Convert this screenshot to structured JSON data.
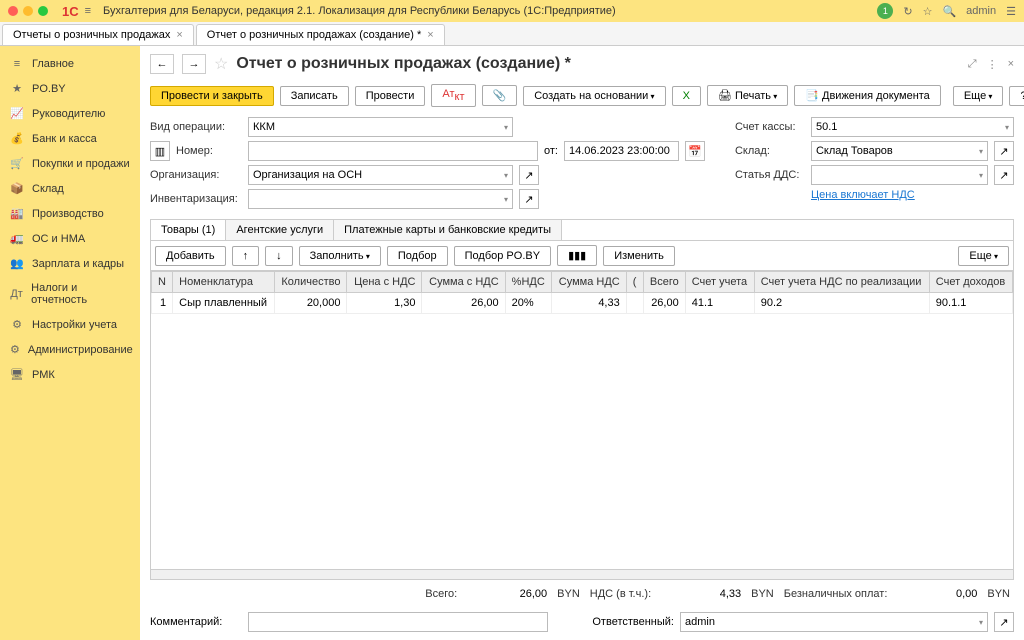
{
  "app_title": "Бухгалтерия для Беларуси, редакция 2.1. Локализация для Республики Беларусь   (1С:Предприятие)",
  "user": "admin",
  "bell_count": "1",
  "doc_tabs": [
    {
      "label": "Отчеты о розничных продажах"
    },
    {
      "label": "Отчет о розничных продажах (создание) *"
    }
  ],
  "sidebar": [
    {
      "icon": "≡",
      "label": "Главное"
    },
    {
      "icon": "★",
      "label": "PO.BY"
    },
    {
      "icon": "📈",
      "label": "Руководителю"
    },
    {
      "icon": "💰",
      "label": "Банк и касса"
    },
    {
      "icon": "🛒",
      "label": "Покупки и продажи"
    },
    {
      "icon": "📦",
      "label": "Склад"
    },
    {
      "icon": "🏭",
      "label": "Производство"
    },
    {
      "icon": "🚛",
      "label": "ОС и НМА"
    },
    {
      "icon": "👥",
      "label": "Зарплата и кадры"
    },
    {
      "icon": "Дт",
      "label": "Налоги и отчетность"
    },
    {
      "icon": "⚙",
      "label": "Настройки учета"
    },
    {
      "icon": "⚙",
      "label": "Администрирование"
    },
    {
      "icon": "🖥",
      "label": "РМК"
    }
  ],
  "page_title": "Отчет о розничных продажах (создание) *",
  "toolbar": {
    "post_close": "Провести и закрыть",
    "save": "Записать",
    "post": "Провести",
    "create_based": "Создать на основании",
    "print": "Печать",
    "movements": "Движения документа",
    "more": "Еще"
  },
  "form": {
    "op_type_label": "Вид операции:",
    "op_type": "ККМ",
    "number_label": "Номер:",
    "number": "",
    "from_label": "от:",
    "date": "14.06.2023 23:00:00",
    "org_label": "Организация:",
    "org": "Организация на ОСН",
    "inv_label": "Инвентаризация:",
    "cash_account_label": "Счет кассы:",
    "cash_account": "50.1",
    "warehouse_label": "Склад:",
    "warehouse": "Склад Товаров",
    "dds_label": "Статья ДДС:",
    "price_link": "Цена включает НДС"
  },
  "subtabs": [
    "Товары (1)",
    "Агентские услуги",
    "Платежные карты и банковские кредиты"
  ],
  "table_toolbar": {
    "add": "Добавить",
    "fill": "Заполнить",
    "pick": "Подбор",
    "pick_poby": "Подбор PO.BY",
    "change": "Изменить",
    "more": "Еще"
  },
  "columns": [
    "N",
    "Номенклатура",
    "Количество",
    "Цена с НДС",
    "Сумма с НДС",
    "%НДС",
    "Сумма НДС",
    "(",
    "Всего",
    "Счет учета",
    "Счет учета НДС по реализации",
    "Счет доходов"
  ],
  "rows": [
    {
      "n": "1",
      "nom": "Сыр плавленный",
      "qty": "20,000",
      "price": "1,30",
      "sum": "26,00",
      "vat_rate": "20%",
      "vat_sum": "4,33",
      "extra": "",
      "total": "26,00",
      "acc": "41.1",
      "acc_vat": "90.2",
      "acc_inc": "90.1.1"
    }
  ],
  "totals": {
    "total_label": "Всего:",
    "total": "26,00",
    "cur": "BYN",
    "vat_label": "НДС (в т.ч.):",
    "vat": "4,33",
    "cashless_label": "Безналичных оплат:",
    "cashless": "0,00"
  },
  "footer": {
    "comment_label": "Комментарий:",
    "comment": "",
    "resp_label": "Ответственный:",
    "resp": "admin"
  }
}
